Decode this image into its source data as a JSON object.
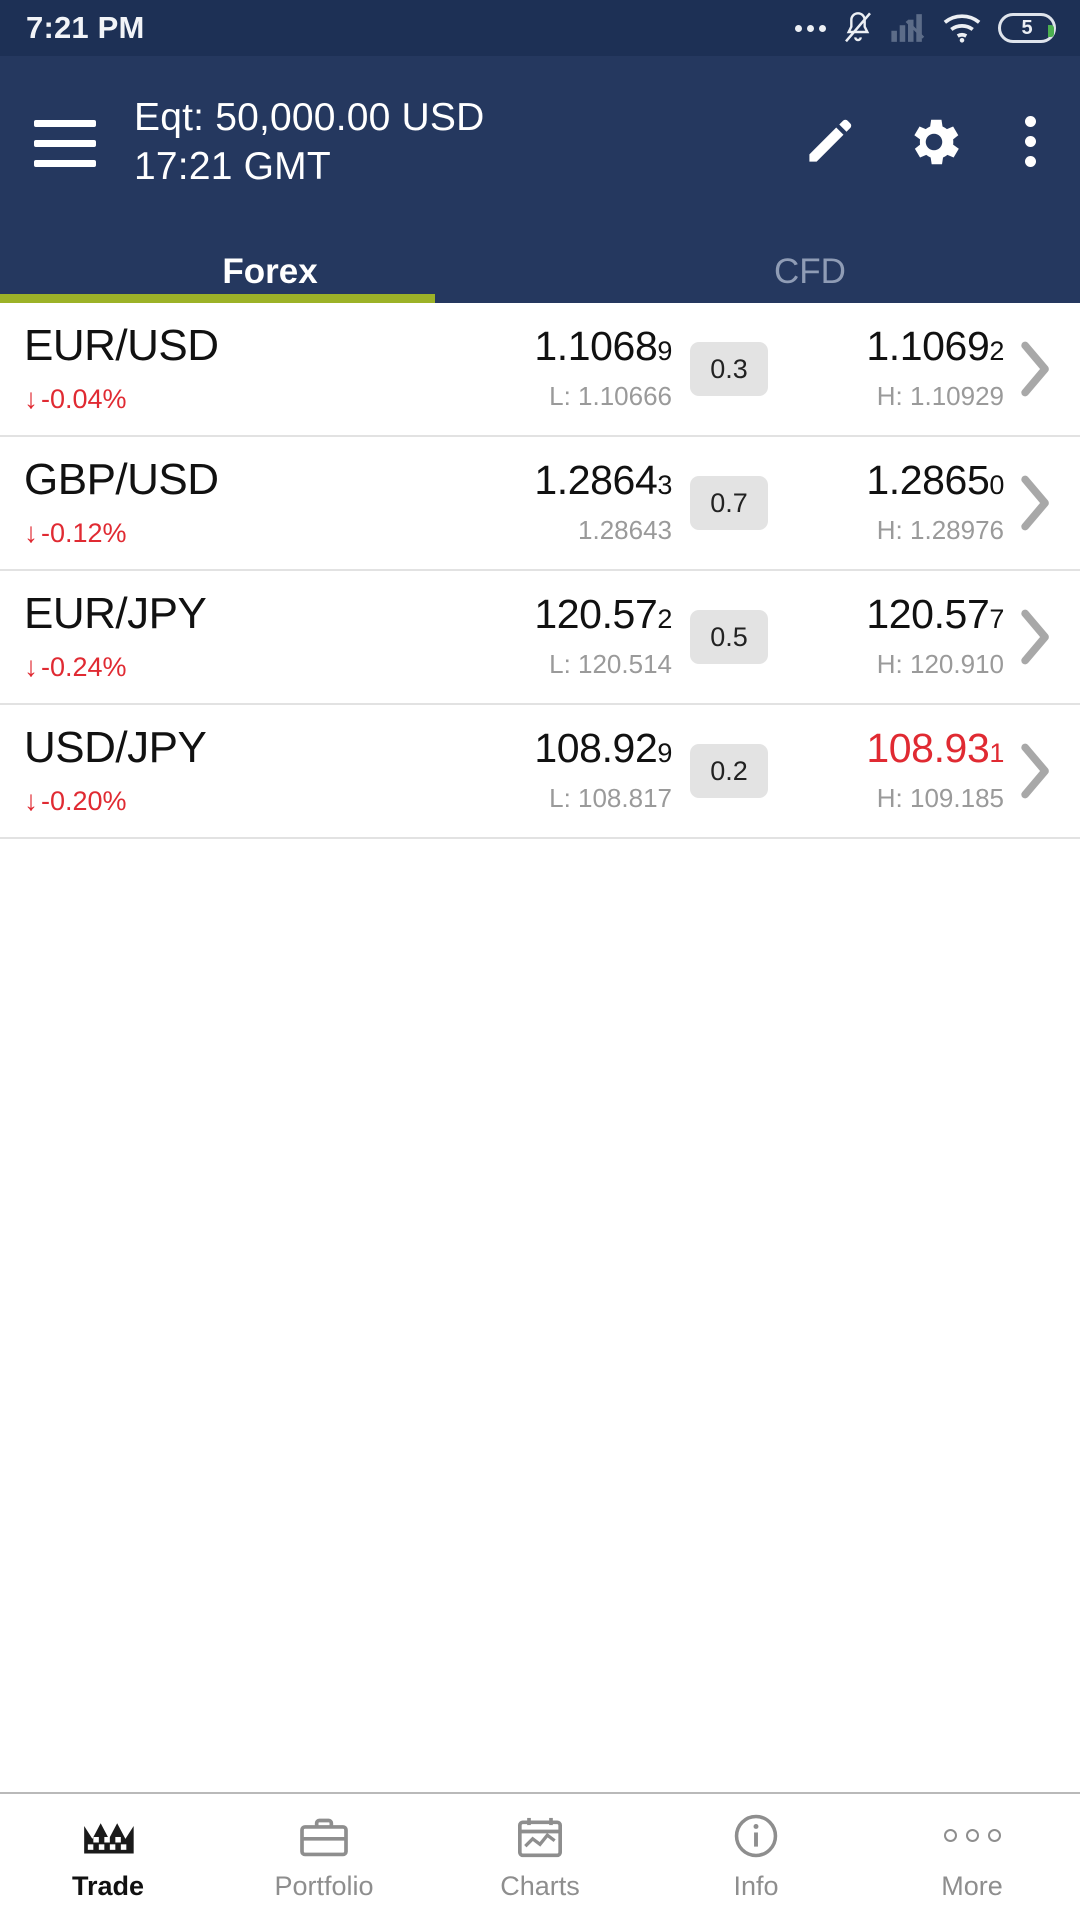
{
  "status_bar": {
    "time": "7:21 PM",
    "icons": [
      "more-dots-icon",
      "bell-muted-icon",
      "cell-signal-icon",
      "wifi-icon",
      "battery-icon"
    ],
    "battery_level": "5"
  },
  "app_bar": {
    "menu_icon": "hamburger-menu-icon",
    "equity_line": "Eqt: 50,000.00 USD",
    "time_line": "17:21 GMT",
    "actions": [
      {
        "name": "edit-pencil-icon",
        "label": "Edit"
      },
      {
        "name": "settings-gear-icon",
        "label": "Settings"
      },
      {
        "name": "overflow-menu-icon",
        "label": "More options"
      }
    ]
  },
  "tabs": {
    "items": [
      {
        "label": "Forex",
        "active": true
      },
      {
        "label": "CFD",
        "active": false
      }
    ],
    "indicator_color": "#9cb228"
  },
  "quotes": {
    "rows": [
      {
        "symbol": "EUR/USD",
        "change": "-0.04%",
        "change_direction": "down",
        "bid": "1.1068",
        "bid_last": "9",
        "bid_color": "black",
        "low": "L: 1.10666",
        "spread": "0.3",
        "ask": "1.1069",
        "ask_last": "2",
        "ask_color": "black",
        "high": "H: 1.10929"
      },
      {
        "symbol": "GBP/USD",
        "change": "-0.12%",
        "change_direction": "down",
        "bid": "1.2864",
        "bid_last": "3",
        "bid_color": "black",
        "low": "1.28643",
        "spread": "0.7",
        "ask": "1.2865",
        "ask_last": "0",
        "ask_color": "black",
        "high": "H: 1.28976"
      },
      {
        "symbol": "EUR/JPY",
        "change": "-0.24%",
        "change_direction": "down",
        "bid": "120.57",
        "bid_last": "2",
        "bid_color": "black",
        "low": "L: 120.514",
        "spread": "0.5",
        "ask": "120.57",
        "ask_last": "7",
        "ask_color": "black",
        "high": "H: 120.910"
      },
      {
        "symbol": "USD/JPY",
        "change": "-0.20%",
        "change_direction": "down",
        "bid": "108.92",
        "bid_last": "9",
        "bid_color": "black",
        "low": "L: 108.817",
        "spread": "0.2",
        "ask": "108.93",
        "ask_last": "1",
        "ask_color": "red",
        "high": "H: 109.185"
      }
    ],
    "down_arrow_glyph": "↓",
    "chevron_glyph": "›"
  },
  "bottom_nav": {
    "items": [
      {
        "label": "Trade",
        "icon": "candlestick-crown-icon",
        "active": true
      },
      {
        "label": "Portfolio",
        "icon": "briefcase-icon",
        "active": false
      },
      {
        "label": "Charts",
        "icon": "chart-icon",
        "active": false
      },
      {
        "label": "Info",
        "icon": "info-circle-icon",
        "active": false
      },
      {
        "label": "More",
        "icon": "more-dots-icon",
        "active": false
      }
    ]
  },
  "colors": {
    "header_bg": "#25385f",
    "status_bg": "#1d3055",
    "accent_green": "#9cb228",
    "negative_red": "#e02a32",
    "spread_badge_bg": "#e3e3e3"
  }
}
